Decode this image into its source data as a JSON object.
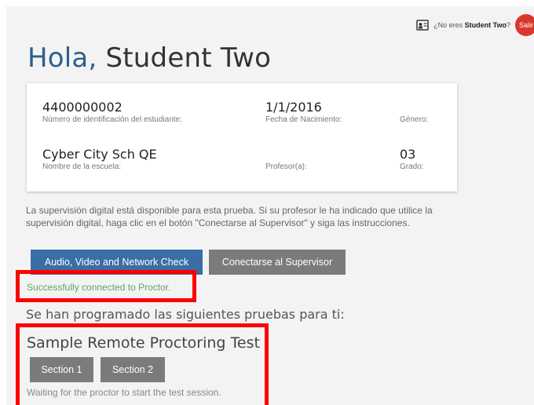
{
  "topbar": {
    "not_you_prefix": "¿No eres ",
    "student_name": "Student Two",
    "not_you_suffix": "?",
    "logout_label": "Salir",
    "icon": "id-card-icon"
  },
  "greeting": {
    "hello": "Hola,",
    "name": "Student Two"
  },
  "student_card": {
    "student_id": "4400000002",
    "student_id_label": "Número de identificación del estudiante:",
    "dob": "1/1/2016",
    "dob_label": "Fecha de Nacimiento:",
    "gender": "",
    "gender_label": "Género:",
    "school": "Cyber City Sch QE",
    "school_label": "Nombre de la escuela:",
    "teacher": "",
    "teacher_label": "Profesor(a):",
    "grade": "03",
    "grade_label": "Grado:"
  },
  "info_text": "La supervisión digital está disponible para esta prueba. Si su profesor le ha indicado que utilice la supervisión digital, haga clic en el botón \"Conectarse al Supervisor\" y siga las instrucciones.",
  "buttons": {
    "av_check": "Audio, Video and Network Check",
    "connect_proctor": "Conectarse al Supervisor"
  },
  "status": {
    "connected": "Successfully connected to Proctor."
  },
  "scheduled_heading": "Se han programado las siguientes pruebas para ti:",
  "test": {
    "name": "Sample Remote Proctoring Test",
    "sections": [
      "Section 1",
      "Section 2"
    ],
    "waiting": "Waiting for the proctor to start the test session."
  },
  "colors": {
    "primary_button": "#3a6ea5",
    "gray_button": "#7b7b7b",
    "success_text": "#5aa75a",
    "highlight": "#ff0000",
    "logout": "#d9372b"
  }
}
